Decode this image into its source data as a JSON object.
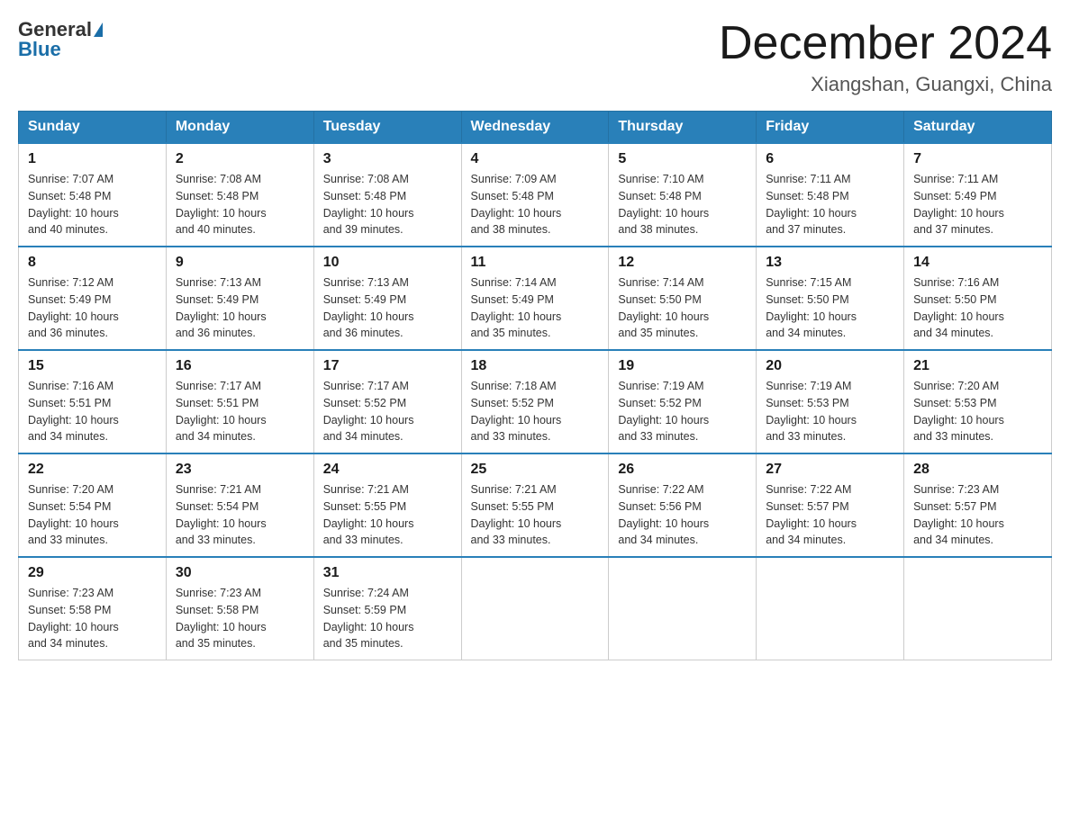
{
  "header": {
    "logo_general": "General",
    "logo_blue": "Blue",
    "title": "December 2024",
    "location": "Xiangshan, Guangxi, China"
  },
  "days_of_week": [
    "Sunday",
    "Monday",
    "Tuesday",
    "Wednesday",
    "Thursday",
    "Friday",
    "Saturday"
  ],
  "weeks": [
    [
      {
        "day": "1",
        "sunrise": "7:07 AM",
        "sunset": "5:48 PM",
        "daylight": "10 hours and 40 minutes."
      },
      {
        "day": "2",
        "sunrise": "7:08 AM",
        "sunset": "5:48 PM",
        "daylight": "10 hours and 40 minutes."
      },
      {
        "day": "3",
        "sunrise": "7:08 AM",
        "sunset": "5:48 PM",
        "daylight": "10 hours and 39 minutes."
      },
      {
        "day": "4",
        "sunrise": "7:09 AM",
        "sunset": "5:48 PM",
        "daylight": "10 hours and 38 minutes."
      },
      {
        "day": "5",
        "sunrise": "7:10 AM",
        "sunset": "5:48 PM",
        "daylight": "10 hours and 38 minutes."
      },
      {
        "day": "6",
        "sunrise": "7:11 AM",
        "sunset": "5:48 PM",
        "daylight": "10 hours and 37 minutes."
      },
      {
        "day": "7",
        "sunrise": "7:11 AM",
        "sunset": "5:49 PM",
        "daylight": "10 hours and 37 minutes."
      }
    ],
    [
      {
        "day": "8",
        "sunrise": "7:12 AM",
        "sunset": "5:49 PM",
        "daylight": "10 hours and 36 minutes."
      },
      {
        "day": "9",
        "sunrise": "7:13 AM",
        "sunset": "5:49 PM",
        "daylight": "10 hours and 36 minutes."
      },
      {
        "day": "10",
        "sunrise": "7:13 AM",
        "sunset": "5:49 PM",
        "daylight": "10 hours and 36 minutes."
      },
      {
        "day": "11",
        "sunrise": "7:14 AM",
        "sunset": "5:49 PM",
        "daylight": "10 hours and 35 minutes."
      },
      {
        "day": "12",
        "sunrise": "7:14 AM",
        "sunset": "5:50 PM",
        "daylight": "10 hours and 35 minutes."
      },
      {
        "day": "13",
        "sunrise": "7:15 AM",
        "sunset": "5:50 PM",
        "daylight": "10 hours and 34 minutes."
      },
      {
        "day": "14",
        "sunrise": "7:16 AM",
        "sunset": "5:50 PM",
        "daylight": "10 hours and 34 minutes."
      }
    ],
    [
      {
        "day": "15",
        "sunrise": "7:16 AM",
        "sunset": "5:51 PM",
        "daylight": "10 hours and 34 minutes."
      },
      {
        "day": "16",
        "sunrise": "7:17 AM",
        "sunset": "5:51 PM",
        "daylight": "10 hours and 34 minutes."
      },
      {
        "day": "17",
        "sunrise": "7:17 AM",
        "sunset": "5:52 PM",
        "daylight": "10 hours and 34 minutes."
      },
      {
        "day": "18",
        "sunrise": "7:18 AM",
        "sunset": "5:52 PM",
        "daylight": "10 hours and 33 minutes."
      },
      {
        "day": "19",
        "sunrise": "7:19 AM",
        "sunset": "5:52 PM",
        "daylight": "10 hours and 33 minutes."
      },
      {
        "day": "20",
        "sunrise": "7:19 AM",
        "sunset": "5:53 PM",
        "daylight": "10 hours and 33 minutes."
      },
      {
        "day": "21",
        "sunrise": "7:20 AM",
        "sunset": "5:53 PM",
        "daylight": "10 hours and 33 minutes."
      }
    ],
    [
      {
        "day": "22",
        "sunrise": "7:20 AM",
        "sunset": "5:54 PM",
        "daylight": "10 hours and 33 minutes."
      },
      {
        "day": "23",
        "sunrise": "7:21 AM",
        "sunset": "5:54 PM",
        "daylight": "10 hours and 33 minutes."
      },
      {
        "day": "24",
        "sunrise": "7:21 AM",
        "sunset": "5:55 PM",
        "daylight": "10 hours and 33 minutes."
      },
      {
        "day": "25",
        "sunrise": "7:21 AM",
        "sunset": "5:55 PM",
        "daylight": "10 hours and 33 minutes."
      },
      {
        "day": "26",
        "sunrise": "7:22 AM",
        "sunset": "5:56 PM",
        "daylight": "10 hours and 34 minutes."
      },
      {
        "day": "27",
        "sunrise": "7:22 AM",
        "sunset": "5:57 PM",
        "daylight": "10 hours and 34 minutes."
      },
      {
        "day": "28",
        "sunrise": "7:23 AM",
        "sunset": "5:57 PM",
        "daylight": "10 hours and 34 minutes."
      }
    ],
    [
      {
        "day": "29",
        "sunrise": "7:23 AM",
        "sunset": "5:58 PM",
        "daylight": "10 hours and 34 minutes."
      },
      {
        "day": "30",
        "sunrise": "7:23 AM",
        "sunset": "5:58 PM",
        "daylight": "10 hours and 35 minutes."
      },
      {
        "day": "31",
        "sunrise": "7:24 AM",
        "sunset": "5:59 PM",
        "daylight": "10 hours and 35 minutes."
      },
      null,
      null,
      null,
      null
    ]
  ],
  "labels": {
    "sunrise": "Sunrise:",
    "sunset": "Sunset:",
    "daylight": "Daylight:"
  }
}
